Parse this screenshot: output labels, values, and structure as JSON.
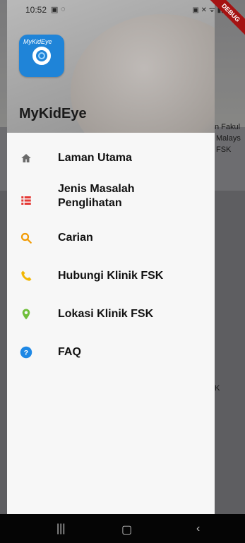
{
  "status_bar": {
    "time": "10:52"
  },
  "debug_banner": "DEBUG",
  "background": {
    "snippet_1": "n  Fakul",
    "snippet_2": "Malays",
    "snippet_3": "FSK",
    "snippet_4": "K"
  },
  "drawer": {
    "logo_text": "MyKidEye",
    "brand_title": "MyKidEye",
    "items": [
      {
        "label": "Laman Utama",
        "icon": "home-icon",
        "color": "#6b6b6b"
      },
      {
        "label": "Jenis Masalah Penglihatan",
        "icon": "list-icon",
        "color": "#e53935"
      },
      {
        "label": "Carian",
        "icon": "search-icon",
        "color": "#f29b05"
      },
      {
        "label": "Hubungi Klinik FSK",
        "icon": "phone-icon",
        "color": "#f2b705"
      },
      {
        "label": "Lokasi Klinik FSK",
        "icon": "location-icon",
        "color": "#6fbf3a"
      },
      {
        "label": "FAQ",
        "icon": "help-icon",
        "color": "#1e88e5"
      }
    ]
  }
}
